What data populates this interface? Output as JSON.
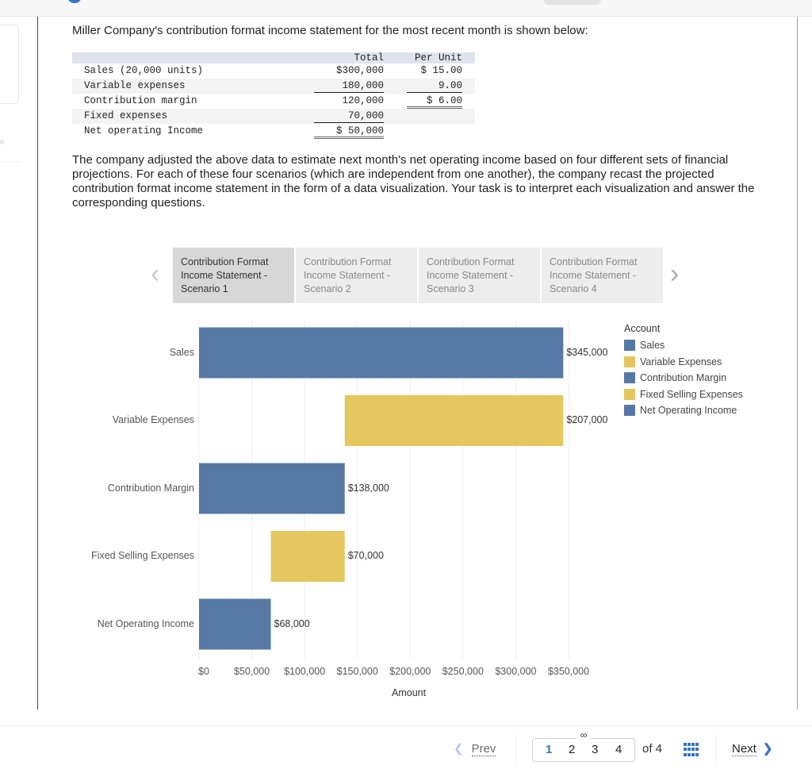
{
  "intro_text": "Miller Company's contribution format income statement for the most recent month is shown below:",
  "statement": {
    "headers": {
      "total": "Total",
      "per_unit": "Per Unit"
    },
    "rows": [
      {
        "label": "Sales (20,000 units)",
        "total": "$300,000",
        "per_unit": "$ 15.00"
      },
      {
        "label": "Variable expenses",
        "total": "180,000",
        "per_unit": "9.00"
      },
      {
        "label": "Contribution margin",
        "total": "120,000",
        "per_unit": "$ 6.00"
      },
      {
        "label": "Fixed expenses",
        "total": "70,000",
        "per_unit": ""
      },
      {
        "label": "Net operating Income",
        "total": "$ 50,000",
        "per_unit": ""
      }
    ]
  },
  "paragraph": "The company adjusted the above data to estimate next month's net operating income based on four different sets of financial projections. For each of these four scenarios (which are independent from one another), the company recast the projected contribution format income statement in the form of a data visualization. Your task is to interpret each visualization and answer the corresponding questions.",
  "tabs": {
    "prev_icon": "chevron-left-icon",
    "next_icon": "chevron-right-icon",
    "items": [
      {
        "label": "Contribution Format Income Statement - Scenario 1",
        "active": true
      },
      {
        "label": "Contribution Format Income Statement - Scenario 2",
        "active": false
      },
      {
        "label": "Contribution Format Income Statement - Scenario 3",
        "active": false
      },
      {
        "label": "Contribution Format Income Statement - Scenario 4",
        "active": false
      }
    ]
  },
  "colors": {
    "blue": "#5778a4",
    "yellow": "#e6c75f",
    "accent": "#3b73c4",
    "gridline": "#eeeeee"
  },
  "chart_data": {
    "type": "bar",
    "orientation": "horizontal",
    "subtype": "waterfall",
    "title": "Contribution Format Income Statement - Scenario 1",
    "xlabel": "Amount",
    "ylabel": "",
    "xlim": [
      0,
      350000
    ],
    "x_ticks": [
      0,
      50000,
      100000,
      150000,
      200000,
      250000,
      300000,
      350000
    ],
    "x_tick_labels": [
      "$0",
      "$50,000",
      "$100,000",
      "$150,000",
      "$200,000",
      "$250,000",
      "$300,000",
      "$350,000"
    ],
    "grid": true,
    "categories": [
      "Sales",
      "Variable Expenses",
      "Contribution Margin",
      "Fixed Selling Expenses",
      "Net Operating Income"
    ],
    "values": [
      345000,
      207000,
      138000,
      70000,
      68000
    ],
    "starts": [
      0,
      138000,
      0,
      68000,
      0
    ],
    "ends": [
      345000,
      345000,
      138000,
      138000,
      68000
    ],
    "value_labels": [
      "$345,000",
      "$207,000",
      "$138,000",
      "$70,000",
      "$68,000"
    ],
    "bar_colors": [
      "blue",
      "yellow",
      "blue",
      "yellow",
      "blue"
    ],
    "legend": {
      "title": "Account",
      "position": "right",
      "items": [
        {
          "label": "Sales",
          "color": "blue"
        },
        {
          "label": "Variable Expenses",
          "color": "yellow"
        },
        {
          "label": "Contribution Margin",
          "color": "blue"
        },
        {
          "label": "Fixed Selling Expenses",
          "color": "yellow"
        },
        {
          "label": "Net Operating Income",
          "color": "blue"
        }
      ]
    }
  },
  "footer": {
    "prev_label": "Prev",
    "next_label": "Next",
    "pages": [
      "1",
      "2",
      "3",
      "4"
    ],
    "current_page": "1",
    "of_label": "of 4",
    "link_icon": "link-icon",
    "grid_icon": "grid-icon"
  }
}
